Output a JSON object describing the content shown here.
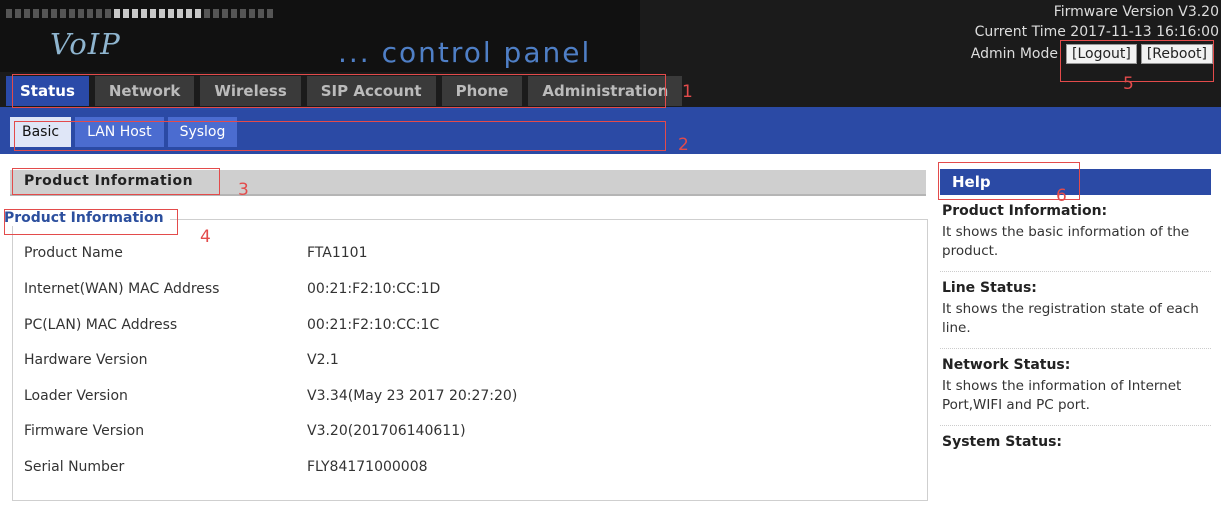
{
  "header": {
    "brand_voip": "VoIP",
    "brand_cp": "... control panel",
    "firmware_version": "Firmware Version V3.20",
    "current_time": "Current Time 2017-11-13 16:16:00",
    "admin_mode_label": "Admin Mode",
    "logout_label": "[Logout]",
    "reboot_label": "[Reboot]"
  },
  "main_tabs": [
    {
      "label": "Status",
      "active": true
    },
    {
      "label": "Network",
      "active": false
    },
    {
      "label": "Wireless",
      "active": false
    },
    {
      "label": "SIP Account",
      "active": false
    },
    {
      "label": "Phone",
      "active": false
    },
    {
      "label": "Administration",
      "active": false
    }
  ],
  "sub_tabs": [
    {
      "label": "Basic",
      "active": true
    },
    {
      "label": "LAN Host",
      "active": false
    },
    {
      "label": "Syslog",
      "active": false
    }
  ],
  "section": {
    "title": "Product Information",
    "legend": "Product Information"
  },
  "product_info": [
    {
      "label": "Product Name",
      "value": "FTA1101"
    },
    {
      "label": "Internet(WAN) MAC Address",
      "value": "00:21:F2:10:CC:1D"
    },
    {
      "label": "PC(LAN) MAC Address",
      "value": "00:21:F2:10:CC:1C"
    },
    {
      "label": "Hardware Version",
      "value": "V2.1"
    },
    {
      "label": "Loader Version",
      "value": "V3.34(May 23 2017 20:27:20)"
    },
    {
      "label": "Firmware Version",
      "value": "V3.20(201706140611)"
    },
    {
      "label": "Serial Number",
      "value": "FLY84171000008"
    }
  ],
  "help": {
    "title": "Help",
    "items": [
      {
        "heading": "Product Information:",
        "text": "It shows the basic information of the product."
      },
      {
        "heading": "Line Status:",
        "text": "It shows the registration state of each line."
      },
      {
        "heading": "Network Status:",
        "text": "It shows the information of Internet Port,WIFI and PC port."
      },
      {
        "heading": "System Status:",
        "text": ""
      }
    ]
  },
  "annotations": [
    "1",
    "2",
    "3",
    "4",
    "5",
    "6"
  ],
  "colors": {
    "header_bg": "#1b1b1b",
    "nav_blue": "#2b4aa5",
    "annotation_red": "#e34b4b",
    "legend_blue": "#2c4f9e"
  }
}
